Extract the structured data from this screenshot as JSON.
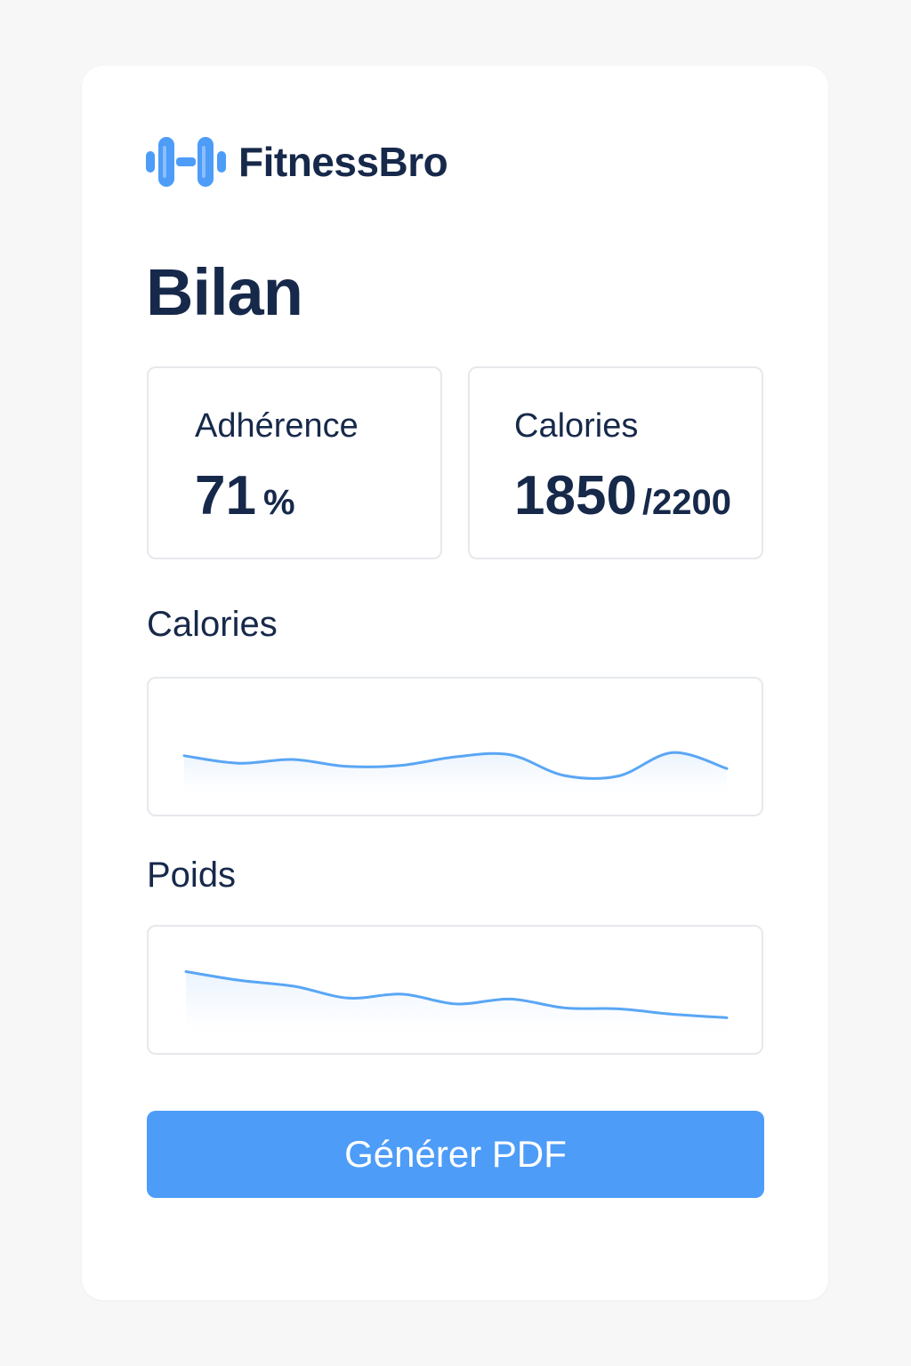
{
  "brand": {
    "name": "FitnessBro",
    "icon": "dumbbell-icon"
  },
  "page": {
    "title": "Bilan"
  },
  "stats": {
    "adherence": {
      "label": "Adhérence",
      "value": "71",
      "unit": "%",
      "percent": 71
    },
    "calories": {
      "label": "Calories",
      "value": "1850",
      "target": "/2200"
    }
  },
  "sections": {
    "calories_title": "Calories",
    "weight_title": "Poids"
  },
  "actions": {
    "generate_pdf": "Générer PDF"
  },
  "colors": {
    "accent": "#4d9cf8",
    "text": "#17294a",
    "line": "#5aa6f5",
    "fill": "#eaf3fe"
  },
  "chart_data": [
    {
      "type": "area",
      "title": "Calories",
      "x": [
        1,
        2,
        3,
        4,
        5,
        6,
        7,
        8,
        9,
        10,
        11
      ],
      "series": [
        {
          "values": [
            0.42,
            0.28,
            0.35,
            0.22,
            0.24,
            0.4,
            0.44,
            0.05,
            0.04,
            0.48,
            0.18
          ]
        }
      ],
      "ylim": [
        -0.3,
        1.2
      ],
      "grid": false
    },
    {
      "type": "area",
      "title": "Poids",
      "x": [
        1,
        2,
        3,
        4,
        5,
        6,
        7,
        8,
        9,
        10,
        11
      ],
      "series": [
        {
          "values": [
            0.96,
            0.78,
            0.66,
            0.42,
            0.5,
            0.3,
            0.4,
            0.22,
            0.2,
            0.09,
            0.02
          ]
        }
      ],
      "ylim": [
        -0.3,
        1.15
      ],
      "grid": false
    }
  ]
}
